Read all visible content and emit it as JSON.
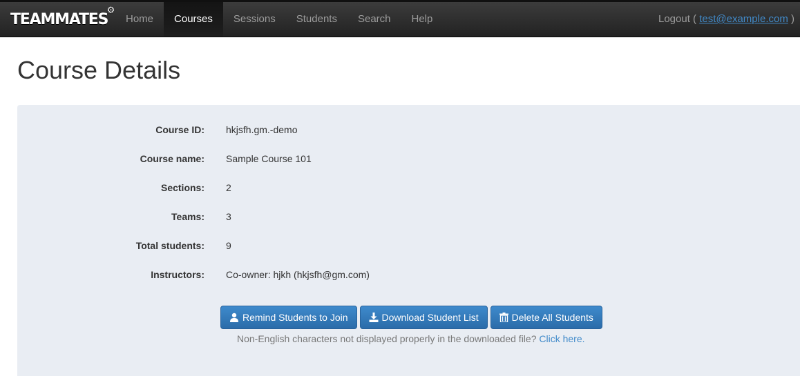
{
  "navbar": {
    "brand": "TEAMMATES",
    "items": [
      {
        "label": "Home"
      },
      {
        "label": "Courses"
      },
      {
        "label": "Sessions"
      },
      {
        "label": "Students"
      },
      {
        "label": "Search"
      },
      {
        "label": "Help"
      }
    ],
    "active": "Courses",
    "logout_prefix": "Logout (",
    "user_email": "test@example.com",
    "logout_suffix": ")"
  },
  "page": {
    "title": "Course Details"
  },
  "details": [
    {
      "label": "Course ID:",
      "value": "hkjsfh.gm.-demo"
    },
    {
      "label": "Course name:",
      "value": "Sample Course 101"
    },
    {
      "label": "Sections:",
      "value": "2"
    },
    {
      "label": "Teams:",
      "value": "3"
    },
    {
      "label": "Total students:",
      "value": "9"
    },
    {
      "label": "Instructors:",
      "value": "Co-owner: hjkh (hkjsfh@gm.com)"
    }
  ],
  "actions": {
    "remind_label": "Remind Students to Join",
    "download_label": "Download Student List",
    "delete_label": "Delete All Students",
    "remind_icon": "user-icon",
    "download_icon": "download-icon",
    "delete_icon": "trash-icon"
  },
  "note": {
    "text": "Non-English characters not displayed properly in the downloaded file?",
    "link": "Click here."
  },
  "colors": {
    "navbar_bg": "#222222",
    "panel_bg": "#e9edf3",
    "button_primary": "#337ab7",
    "link": "#428bca"
  }
}
